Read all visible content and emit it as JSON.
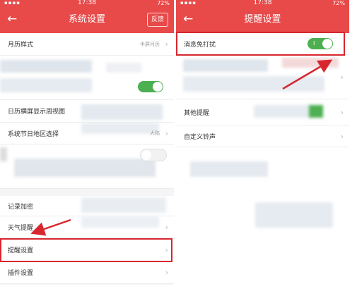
{
  "left": {
    "status": {
      "time": "17:38",
      "battery": "72%"
    },
    "title": "系统设置",
    "back_glyph": "←",
    "feedback": "反馈",
    "rows": [
      {
        "label": "月历样式",
        "value": "半屏月历"
      },
      {
        "label": "日历横屏显示周视图"
      },
      {
        "label": "系统节日地区选择",
        "value": "大陆"
      },
      {
        "label": "记录加密"
      },
      {
        "label": "天气提醒"
      },
      {
        "label": "提醒设置"
      },
      {
        "label": "插件设置"
      }
    ]
  },
  "right": {
    "status": {
      "time": "17:38",
      "battery": "72%"
    },
    "title": "提醒设置",
    "back_glyph": "←",
    "rows": [
      {
        "label": "消息免打扰",
        "toggle": "on"
      },
      {
        "label": "其他提醒"
      },
      {
        "label": "自定义铃声"
      }
    ]
  },
  "chevron_glyph": "›",
  "colors": {
    "header": "#e84949",
    "toggle_on": "#4caf50",
    "highlight": "#d8262f"
  }
}
